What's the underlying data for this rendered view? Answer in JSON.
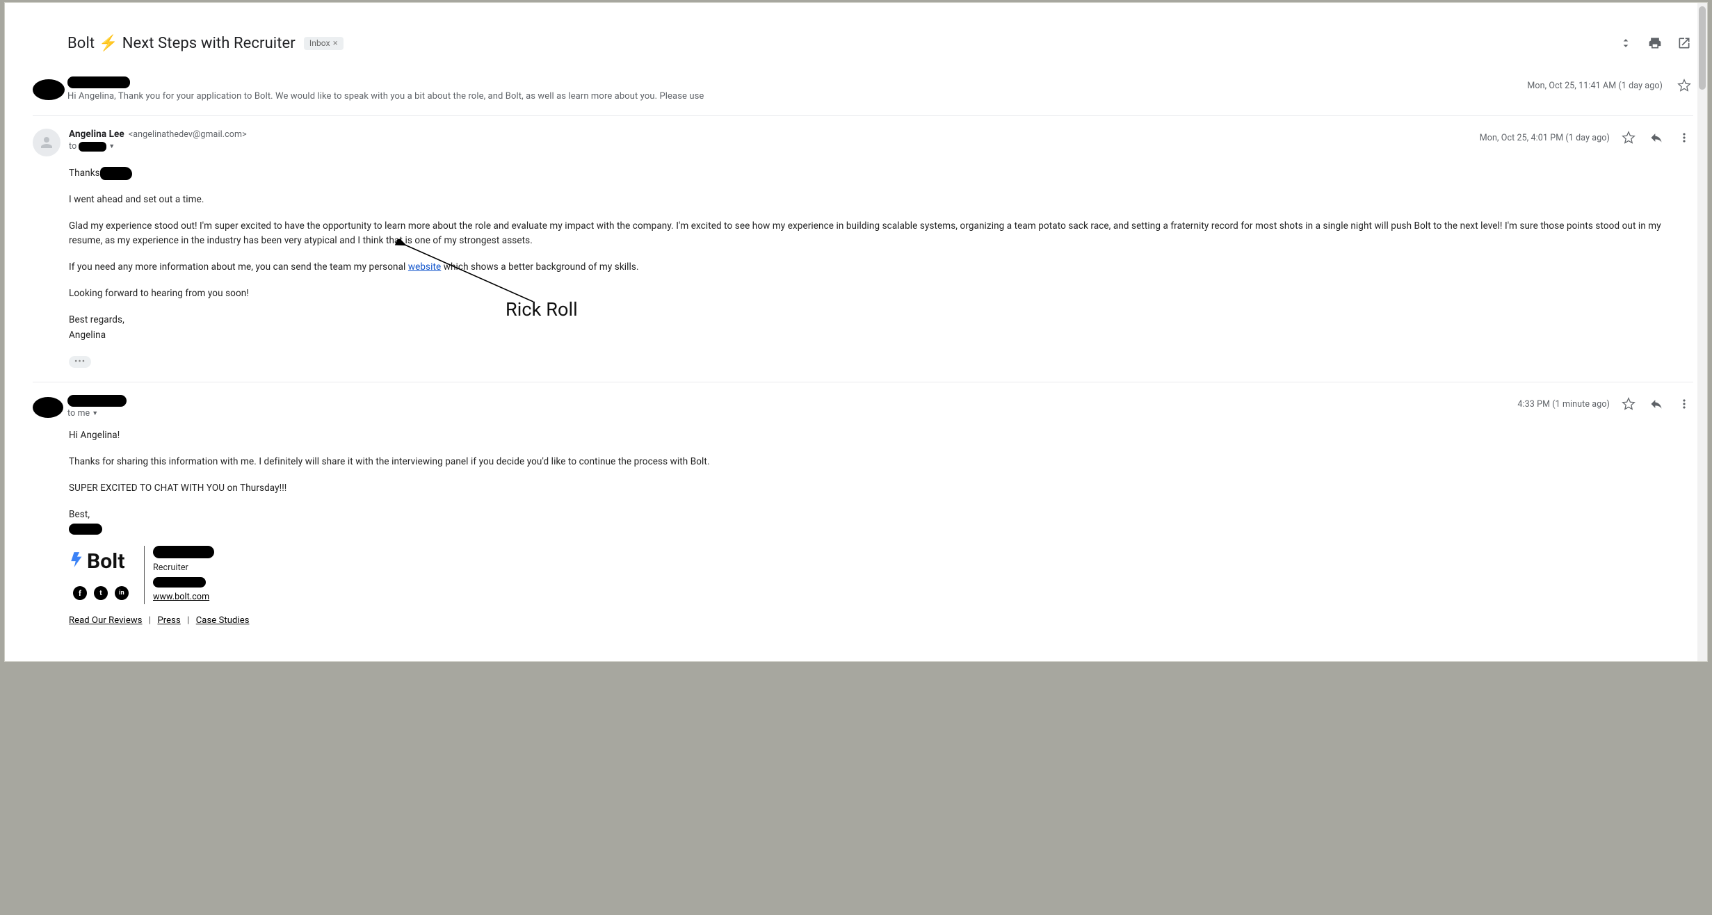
{
  "subject": {
    "prefix": "Bolt",
    "emoji": "⚡",
    "suffix": "Next Steps with Recruiter"
  },
  "label": {
    "name": "Inbox",
    "close": "×"
  },
  "msg1": {
    "timestamp": "Mon, Oct 25, 11:41 AM (1 day ago)",
    "preview": "Hi Angelina, Thank you for your application to Bolt. We would like to speak with you a bit about the role, and Bolt, as well as learn more about you. Please use"
  },
  "msg2": {
    "sender_name": "Angelina Lee",
    "sender_email": "<angelinathedev@gmail.com>",
    "to_prefix": "to",
    "timestamp": "Mon, Oct 25, 4:01 PM (1 day ago)",
    "body": {
      "thanks": "Thanks",
      "p1": "I went ahead and set out a time.",
      "p2": "Glad my experience stood out! I'm super excited to have the opportunity to learn more about the role and evaluate my impact with the company. I'm excited to see how my experience in building scalable systems, organizing a team potato sack race, and setting a fraternity record for most shots in a single night will push Bolt to the next level! I'm sure those points stood out in my resume, as my experience in the industry has been very atypical and I think that is one of my strongest assets.",
      "p3a": "If you need any more information about me, you can send the team my personal ",
      "website_link": "website",
      "p3b": " which shows a better background of my skills.",
      "p4": "Looking forward to hearing from you soon!",
      "sig1": "Best regards,",
      "sig2": "Angelina"
    },
    "trimmed": "•••"
  },
  "msg3": {
    "to_prefix": "to me",
    "timestamp": "4:33 PM (1 minute ago)",
    "body": {
      "p1": "Hi Angelina!",
      "p2": "Thanks for sharing this information with me. I definitely will share it with the interviewing panel if you decide you'd like to continue the process with Bolt.",
      "p3": "SUPER EXCITED TO CHAT WITH YOU on Thursday!!!",
      "p4": "Best,"
    },
    "sig": {
      "brand": "Bolt",
      "role": "Recruiter",
      "url": "www.bolt.com",
      "links": {
        "a": "Read Our Reviews",
        "b": "Press",
        "c": "Case Studies"
      },
      "social": {
        "fb": "f",
        "tw": "t",
        "in": "in"
      }
    }
  },
  "annotation": "Rick Roll"
}
